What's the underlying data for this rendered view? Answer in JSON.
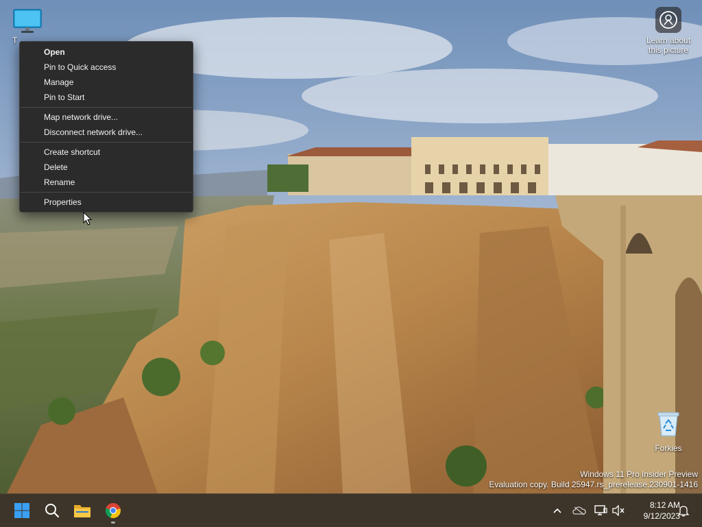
{
  "desktop": {
    "this_pc_label": "T",
    "learn_label_line1": "Learn about",
    "learn_label_line2": "this picture",
    "recycle_label": "Forkies"
  },
  "watermark": {
    "line1": "Windows 11 Pro Insider Preview",
    "line2": "Evaluation copy. Build 25947.rs_prerelease.230901-1416"
  },
  "context_menu": {
    "group1": [
      "Open",
      "Pin to Quick access",
      "Manage",
      "Pin to Start"
    ],
    "group2": [
      "Map network drive...",
      "Disconnect network drive..."
    ],
    "group3": [
      "Create shortcut",
      "Delete",
      "Rename"
    ],
    "group4": [
      "Properties"
    ]
  },
  "taskbar": {
    "icons": [
      "windows-start-icon",
      "search-icon",
      "file-explorer-icon",
      "chrome-icon"
    ],
    "tray_icons": [
      "chevron-up-icon",
      "onedrive-icon",
      "network-icon",
      "volume-muted-icon",
      "notification-bell-icon"
    ],
    "time": "8:12 AM",
    "date": "9/12/2023"
  },
  "colors": {
    "taskbar": "#3d3529",
    "menu_bg": "#2b2b2b",
    "start_blue": "#1e90ff"
  }
}
